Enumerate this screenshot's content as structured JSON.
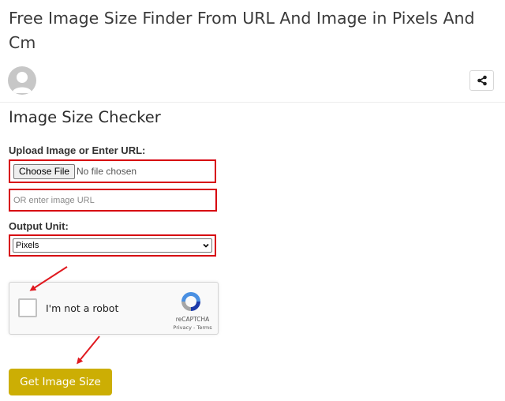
{
  "page": {
    "title": "Free Image Size Finder From URL And Image in Pixels And Cm"
  },
  "header": {
    "avatar_icon": "user-avatar-icon",
    "share_icon": "share-icon"
  },
  "tool": {
    "heading": "Image Size Checker",
    "upload_label": "Upload Image or Enter URL:",
    "choose_file_label": "Choose File",
    "file_status": "No file chosen",
    "url_placeholder": "OR enter image URL",
    "output_label": "Output Unit:",
    "output_selected": "Pixels",
    "submit_label": "Get Image Size"
  },
  "captcha": {
    "label": "I'm not a robot",
    "brand": "reCAPTCHA",
    "privacy_link": "Privacy",
    "separator": "-",
    "terms_link": "Terms"
  },
  "colors": {
    "highlight_red": "#d7000f",
    "button_gold": "#ccae04",
    "annotation_arrow": "#e0191f"
  }
}
